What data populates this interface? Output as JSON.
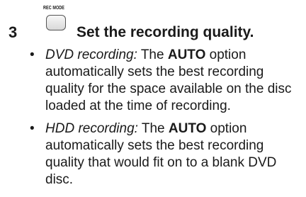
{
  "step": {
    "number": "3",
    "button_label": "REC MODE",
    "title": "Set the recording quality."
  },
  "bullets": [
    {
      "lead": "DVD recording:",
      "pre": " The ",
      "keyword": "AUTO",
      "rest": " option automatically sets the best recording quality for the space available on the disc loaded at the time of recording."
    },
    {
      "lead": "HDD recording:",
      "pre": " The ",
      "keyword": "AUTO",
      "rest": " option automatically sets the best recording quality that would fit on to a blank DVD disc."
    }
  ]
}
